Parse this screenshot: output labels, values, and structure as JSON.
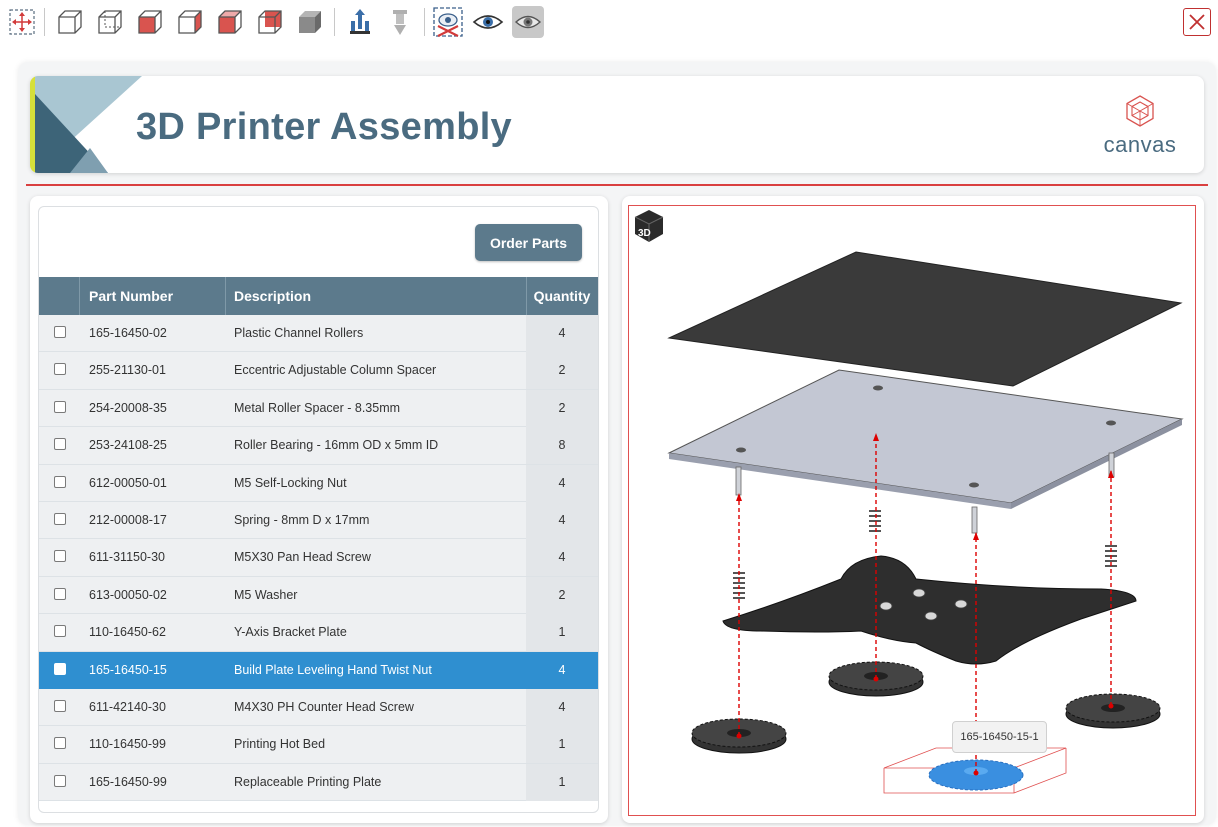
{
  "toolbar": {
    "buttons": [
      {
        "icon": "fit-view-icon"
      },
      {
        "icon": "view-iso-icon"
      },
      {
        "icon": "view-front-icon"
      },
      {
        "icon": "view-left-icon"
      },
      {
        "icon": "view-right-icon"
      },
      {
        "icon": "view-top-icon"
      },
      {
        "icon": "view-back-icon"
      },
      {
        "icon": "shaded-cube-icon"
      },
      {
        "icon": "explode-icon"
      },
      {
        "icon": "collapse-icon"
      },
      {
        "icon": "hide-selected-icon"
      },
      {
        "icon": "eye-icon"
      },
      {
        "icon": "show-all-eye-icon"
      }
    ],
    "close_icon": "close-icon"
  },
  "header": {
    "title": "3D Printer Assembly",
    "logo_text": "canvas"
  },
  "parts": {
    "order_button": "Order Parts",
    "columns": [
      "Part Number",
      "Description",
      "Quantity"
    ],
    "rows": [
      {
        "part": "165-16450-02",
        "desc": "Plastic Channel Rollers",
        "qty": "4"
      },
      {
        "part": "255-21130-01",
        "desc": "Eccentric Adjustable Column Spacer",
        "qty": "2"
      },
      {
        "part": "254-20008-35",
        "desc": "Metal Roller Spacer - 8.35mm",
        "qty": "2"
      },
      {
        "part": "253-24108-25",
        "desc": "Roller Bearing - 16mm OD x 5mm ID",
        "qty": "8"
      },
      {
        "part": "612-00050-01",
        "desc": "M5 Self-Locking Nut",
        "qty": "4"
      },
      {
        "part": "212-00008-17",
        "desc": "Spring - 8mm D x 17mm",
        "qty": "4"
      },
      {
        "part": "611-31150-30",
        "desc": "M5X30 Pan Head Screw",
        "qty": "4"
      },
      {
        "part": "613-00050-02",
        "desc": "M5 Washer",
        "qty": "2"
      },
      {
        "part": "110-16450-62",
        "desc": "Y-Axis Bracket Plate",
        "qty": "1"
      },
      {
        "part": "165-16450-15",
        "desc": "Build Plate Leveling Hand Twist Nut",
        "qty": "4",
        "selected": true
      },
      {
        "part": "611-42140-30",
        "desc": "M4X30 PH Counter Head Screw",
        "qty": "4"
      },
      {
        "part": "110-16450-99",
        "desc": "Printing Hot Bed",
        "qty": "1"
      },
      {
        "part": "165-16450-99",
        "desc": "Replaceable Printing Plate",
        "qty": "1"
      }
    ]
  },
  "viewer": {
    "badge": "3D",
    "tooltip": "165-16450-15-1"
  },
  "colors": {
    "accent": "#5c7a8c",
    "selection": "#2f8fd0",
    "highlight_red": "#d94040"
  }
}
